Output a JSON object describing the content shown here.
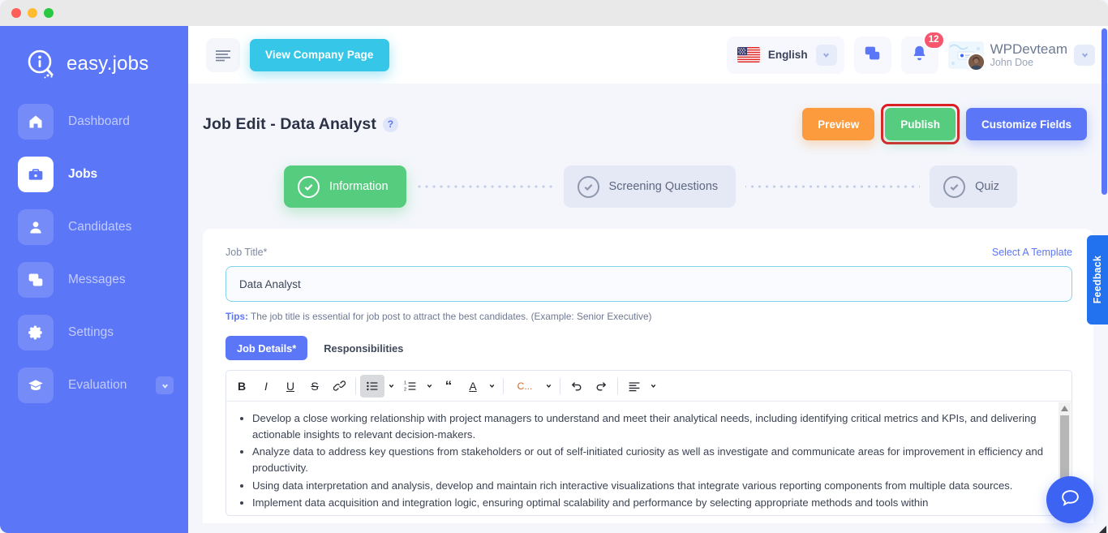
{
  "window": {
    "dots": [
      "close",
      "minimize",
      "maximize"
    ]
  },
  "sidebar": {
    "brand": "easy.jobs",
    "items": [
      {
        "label": "Dashboard",
        "icon": "home-icon",
        "active": false
      },
      {
        "label": "Jobs",
        "icon": "briefcase-icon",
        "active": true
      },
      {
        "label": "Candidates",
        "icon": "user-icon",
        "active": false
      },
      {
        "label": "Messages",
        "icon": "chat-icon",
        "active": false
      },
      {
        "label": "Settings",
        "icon": "gear-icon",
        "active": false
      },
      {
        "label": "Evaluation",
        "icon": "graduation-cap-icon",
        "active": false,
        "expandable": true
      }
    ]
  },
  "topbar": {
    "menu_icon": "hamburger-icon",
    "view_company_label": "View Company Page",
    "language": {
      "name": "English",
      "flag": "us-flag-icon",
      "caret": "chevron-down-icon"
    },
    "messages_icon": "chat-icon",
    "notifications_icon": "bell-icon",
    "notifications_count": "12",
    "user": {
      "company": "WPDevteam",
      "name": "John Doe",
      "caret": "chevron-down-icon"
    }
  },
  "page": {
    "title": "Job Edit - Data Analyst",
    "help_icon": "question-mark-icon",
    "actions": {
      "preview": "Preview",
      "publish": "Publish",
      "customize": "Customize Fields"
    },
    "highlight_color": "#e01b24"
  },
  "stepper": {
    "steps": [
      {
        "label": "Information",
        "state": "active",
        "icon": "check-circle-icon"
      },
      {
        "label": "Screening Questions",
        "state": "inactive",
        "icon": "check-circle-icon"
      },
      {
        "label": "Quiz",
        "state": "inactive",
        "icon": "check-circle-icon"
      }
    ]
  },
  "form": {
    "job_title_label": "Job Title*",
    "select_template_label": "Select A Template",
    "job_title_value": "Data Analyst",
    "job_title_placeholder": "Job Title",
    "tips_prefix": "Tips:",
    "tips_text": " The job title is essential for job post to attract the best candidates. (Example: Senior Executive)",
    "tabs": [
      {
        "label": "Job Details*",
        "active": true
      },
      {
        "label": "Responsibilities",
        "active": false
      }
    ]
  },
  "editor": {
    "toolbar": [
      {
        "name": "bold-icon",
        "glyph": "B"
      },
      {
        "name": "italic-icon",
        "glyph": "I"
      },
      {
        "name": "underline-icon",
        "glyph": "U"
      },
      {
        "name": "strikethrough-icon",
        "glyph": "S"
      },
      {
        "name": "link-icon",
        "glyph": "link"
      },
      {
        "name": "bullet-list-icon",
        "glyph": "ul",
        "active": true
      },
      {
        "name": "numbered-list-icon",
        "glyph": "ol"
      },
      {
        "name": "blockquote-icon",
        "glyph": "“"
      },
      {
        "name": "text-color-icon",
        "glyph": "A"
      },
      {
        "name": "color-dropdown",
        "glyph": "C..."
      },
      {
        "name": "undo-icon",
        "glyph": "undo"
      },
      {
        "name": "redo-icon",
        "glyph": "redo"
      },
      {
        "name": "align-icon",
        "glyph": "align"
      }
    ],
    "color_label": "C...",
    "content": [
      "Develop a close working relationship with project managers to understand and meet their analytical needs, including identifying critical metrics and KPIs, and delivering actionable insights to relevant decision-makers.",
      "Analyze data to address key questions from stakeholders or out of self-initiated curiosity as well as investigate and communicate areas for improvement in efficiency and productivity.",
      "Using data interpretation and analysis, develop and maintain rich interactive visualizations that integrate various reporting components from multiple data sources.",
      "Implement data acquisition and integration logic, ensuring optimal scalability and performance by selecting appropriate methods and tools within"
    ]
  },
  "chrome": {
    "feedback_label": "Feedback",
    "chat_icon": "chat-bubble-icon"
  }
}
